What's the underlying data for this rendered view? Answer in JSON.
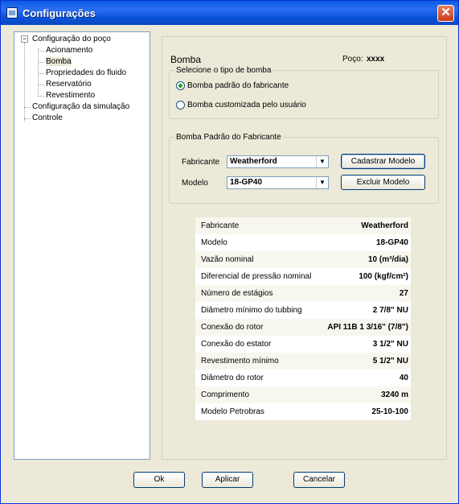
{
  "window": {
    "title": "Configurações",
    "close": "✕"
  },
  "tree": {
    "expander": "−",
    "items": [
      {
        "label": "Configuração do poço"
      },
      {
        "label": "Acionamento"
      },
      {
        "label": "Bomba"
      },
      {
        "label": "Propriedades do fluido"
      },
      {
        "label": "Reservatório"
      },
      {
        "label": "Revestimento"
      },
      {
        "label": "Configuração da simulação"
      },
      {
        "label": "Controle"
      }
    ]
  },
  "pump": {
    "title": "Bomba",
    "well_label": "Poço:",
    "well_value": "xxxx",
    "type_group": {
      "legend": "Selecione o tipo de bomba",
      "option_default": "Bomba padrão do fabricante",
      "option_custom": "Bomba customizada pelo usuário"
    },
    "maker_group": {
      "legend": "Bomba Padrão do Fabricante",
      "manufacturer_label": "Fabricante",
      "manufacturer_value": "Weatherford",
      "model_label": "Modelo",
      "model_value": "18-GP40",
      "register_button": "Cadastrar Modelo",
      "delete_button": "Excluir Modelo"
    },
    "specs": [
      {
        "key": "Fabricante",
        "value": "Weatherford"
      },
      {
        "key": "Modelo",
        "value": "18-GP40"
      },
      {
        "key": "Vazão nominal",
        "value": "10 (m³/dia)"
      },
      {
        "key": "Diferencial de pressão nominal",
        "value": "100 (kgf/cm²)"
      },
      {
        "key": "Número de estágios",
        "value": "27"
      },
      {
        "key": "Diâmetro mínimo do tubbing",
        "value": "2 7/8\" NU"
      },
      {
        "key": "Conexão do rotor",
        "value": "API 11B 1 3/16\" (7/8\")"
      },
      {
        "key": "Conexão do estator",
        "value": "3 1/2\" NU"
      },
      {
        "key": "Revestimento mínimo",
        "value": "5 1/2\" NU"
      },
      {
        "key": "Diâmetro do rotor",
        "value": "40"
      },
      {
        "key": "Comprimento",
        "value": "3240 m"
      },
      {
        "key": "Modelo Petrobras",
        "value": "25-10-100"
      }
    ]
  },
  "buttons": {
    "ok": "Ok",
    "apply": "Aplicar",
    "cancel": "Cancelar"
  }
}
